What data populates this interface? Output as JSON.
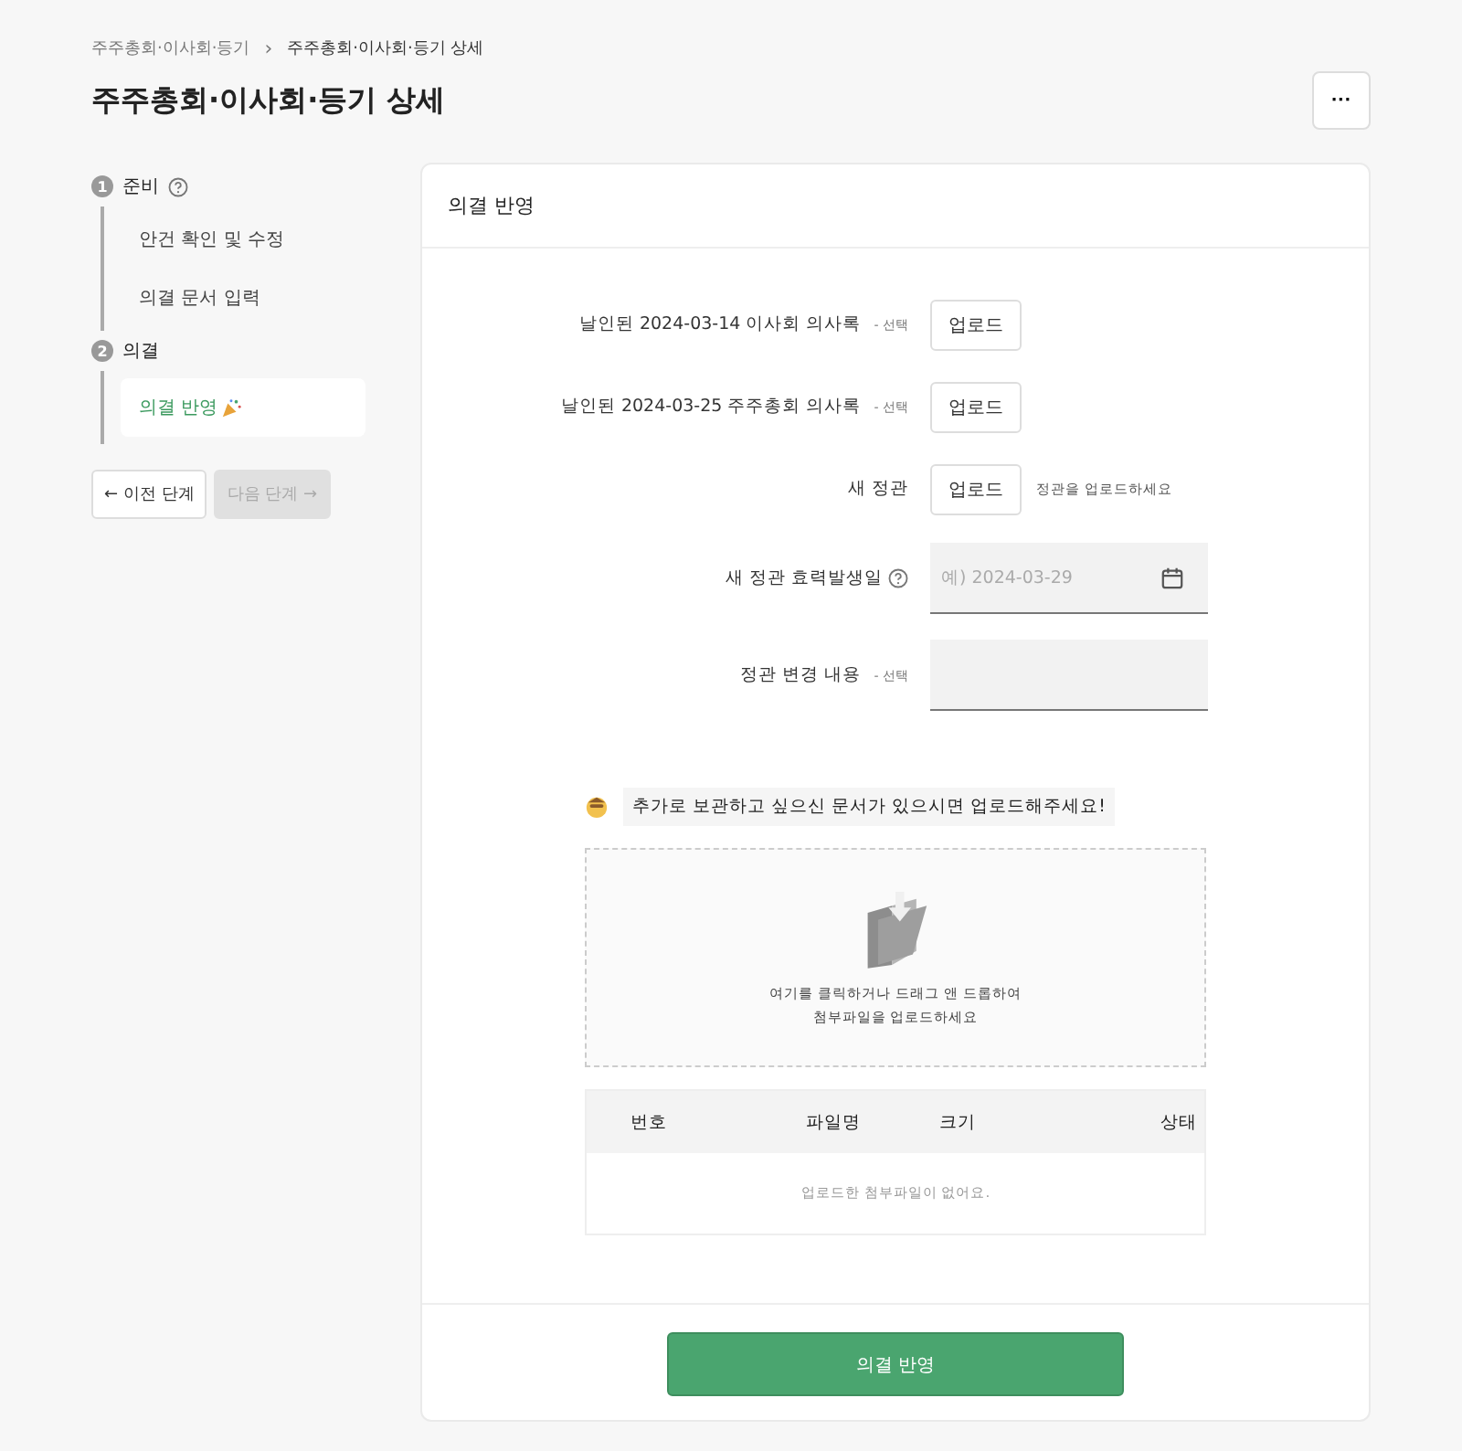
{
  "breadcrumb": [
    {
      "label": "주주총회·이사회·등기",
      "current": false
    },
    {
      "label": "주주총회·이사회·등기 상세",
      "current": true
    }
  ],
  "breadcrumb_separator": "›",
  "page_title": "주주총회·이사회·등기 상세",
  "more_button": "···",
  "steps": [
    {
      "number": "1",
      "label": "준비",
      "help": true,
      "children": [
        {
          "label": "안건 확인 및 수정",
          "selected": false
        },
        {
          "label": "의결 문서 입력",
          "selected": false
        }
      ]
    },
    {
      "number": "2",
      "label": "의결",
      "help": false,
      "children": [
        {
          "label": "의결 반영",
          "selected": true
        }
      ]
    }
  ],
  "nav_buttons": [
    {
      "label": "← 이전 단계",
      "disabled": false
    },
    {
      "label": "다음 단계 →",
      "disabled": true
    }
  ],
  "card_title": "의결 반영",
  "form": [
    {
      "kind": "upload",
      "label": "날인된 2024-03-14 이사회 의사록",
      "optional": "- 선택",
      "help": false,
      "button": "업로드"
    },
    {
      "kind": "upload",
      "label": "날인된 2024-03-25 주주총회 의사록",
      "optional": "- 선택",
      "help": false,
      "button": "업로드"
    },
    {
      "kind": "upload",
      "label": "새 정관",
      "help": false,
      "button": "업로드",
      "hint": "정관을 업로드하세요"
    },
    {
      "kind": "date",
      "label": "새 정관 효력발생일",
      "help": true,
      "placeholder": "예) 2024-03-29"
    },
    {
      "kind": "text",
      "label": "정관 변경 내용",
      "optional": "- 선택",
      "help": false
    }
  ],
  "notice": "추가로 보관하고 싶으신 문서가 있으시면 업로드해주세요!",
  "dropzone": [
    "여기를 클릭하거나 드래그 앤 드롭하여",
    "첨부파일을 업로드하세요"
  ],
  "table": {
    "columns": [
      "번호",
      "파일명",
      "크기",
      "상태"
    ],
    "empty": "업로드한 첨부파일이 없어요."
  },
  "submit": "의결 반영"
}
